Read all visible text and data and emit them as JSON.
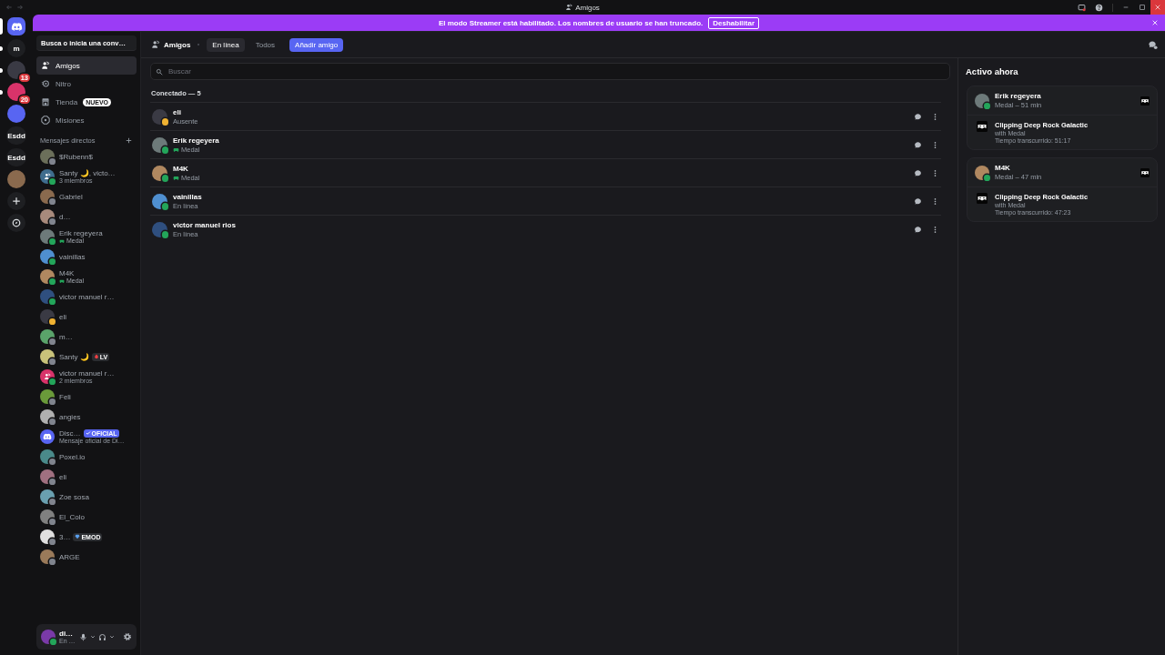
{
  "window": {
    "title": "Amigos"
  },
  "server_rail": [
    {
      "kind": "home",
      "selected": true,
      "unread": false
    },
    {
      "kind": "letter",
      "label": "m",
      "selected": false,
      "unread": true
    },
    {
      "kind": "avatar",
      "badge": "13",
      "selected": false,
      "unread": true
    },
    {
      "kind": "avatar",
      "badge": "20",
      "selected": false,
      "unread": true
    },
    {
      "kind": "avatar",
      "selected": false,
      "unread": false
    },
    {
      "kind": "letter",
      "label": "Esdd",
      "selected": false,
      "unread": false
    },
    {
      "kind": "letter",
      "label": "Esdd",
      "selected": false,
      "unread": false
    },
    {
      "kind": "avatar",
      "selected": false,
      "unread": false
    },
    {
      "kind": "add",
      "selected": false,
      "unread": false
    },
    {
      "kind": "explore",
      "selected": false,
      "unread": false
    }
  ],
  "banner": {
    "text": "El modo Streamer está habilitado. Los nombres de usuario se han truncado.",
    "button": "Deshabilitar"
  },
  "search_button": "Busca o inicia una conv…",
  "nav": [
    {
      "kind": "friends",
      "label": "Amigos",
      "selected": true
    },
    {
      "kind": "nitro",
      "label": "Nitro",
      "selected": false
    },
    {
      "kind": "shop",
      "label": "Tienda",
      "badge": "NUEVO",
      "selected": false
    },
    {
      "kind": "quests",
      "label": "Misiones",
      "selected": false
    }
  ],
  "dm_header": "Mensajes directos",
  "dm_list": [
    {
      "kind": "user",
      "name": "$Rubenn$",
      "color": "#80848e"
    },
    {
      "kind": "group",
      "name": "Santy 🌙, victo…",
      "subtitle": "3 miembros",
      "color": "#23a55a"
    },
    {
      "kind": "user",
      "name": "Gabriel",
      "color": "#80848e"
    },
    {
      "kind": "user",
      "name": "d…",
      "color": "#80848e"
    },
    {
      "kind": "user",
      "name": "Erik regeyera",
      "activity": "Medal",
      "color": "#23a55a"
    },
    {
      "kind": "user",
      "name": "vainillas",
      "color": "#23a55a"
    },
    {
      "kind": "user",
      "name": "M4K",
      "activity": "Medal",
      "color": "#23a55a"
    },
    {
      "kind": "user",
      "name": "victor manuel r…",
      "color": "#23a55a"
    },
    {
      "kind": "user",
      "name": "eli",
      "color": "#f0b232"
    },
    {
      "kind": "user",
      "name": "m…",
      "color": "#80848e"
    },
    {
      "kind": "user",
      "name": "Santy 🌙",
      "color": "#80848e",
      "tag": {
        "kind": "emblem",
        "text": "LV"
      }
    },
    {
      "kind": "group",
      "name": "victor manuel r…",
      "subtitle": "2 miembros",
      "color": "#23a55a"
    },
    {
      "kind": "user",
      "name": "Feli",
      "color": "#80848e"
    },
    {
      "kind": "user",
      "name": "angies",
      "color": "#80848e"
    },
    {
      "kind": "system",
      "name": "Disc…",
      "subtitle": "Mensaje oficial de Di…",
      "tag": {
        "kind": "official",
        "text": "OFICIAL"
      }
    },
    {
      "kind": "user",
      "name": "Poxel.io",
      "color": "#80848e"
    },
    {
      "kind": "user",
      "name": "eli",
      "color": "#80848e"
    },
    {
      "kind": "user",
      "name": "Zoe sosa",
      "color": "#80848e"
    },
    {
      "kind": "user",
      "name": "El_Colo",
      "color": "#80848e"
    },
    {
      "kind": "user",
      "name": "3…",
      "color": "#80848e",
      "tag": {
        "kind": "gem",
        "text": "EMOD"
      }
    },
    {
      "kind": "user",
      "name": "ARGE",
      "color": "#80848e"
    }
  ],
  "user_panel": {
    "name": "di…",
    "status_text": "En …",
    "color": "#23a55a"
  },
  "header": {
    "title": "Amigos",
    "tabs": [
      {
        "label": "En línea",
        "selected": true
      },
      {
        "label": "Todos",
        "selected": false
      }
    ],
    "add_button": "Añadir amigo"
  },
  "search": {
    "placeholder": "Buscar"
  },
  "section": "Conectado — 5",
  "friends": [
    {
      "name": "eli",
      "color": "#f0b232",
      "subtitle": "Ausente"
    },
    {
      "name": "Erik regeyera",
      "color": "#23a55a",
      "activity": "Medal"
    },
    {
      "name": "M4K",
      "color": "#23a55a",
      "activity": "Medal"
    },
    {
      "name": "vainillas",
      "color": "#23a55a",
      "subtitle": "En línea"
    },
    {
      "name": "victor manuel rios",
      "color": "#23a55a",
      "subtitle": "En línea"
    }
  ],
  "active_now": {
    "title": "Activo ahora",
    "cards": [
      {
        "name": "Erik regeyera",
        "color": "#23a55a",
        "detail": "Medal – 51 min",
        "activity_title": "Clipping Deep Rock Galactic",
        "activity_sub": "with Medal",
        "elapsed": "Tiempo transcurrido: 51:17"
      },
      {
        "name": "M4K",
        "color": "#23a55a",
        "detail": "Medal – 47 min",
        "activity_title": "Clipping Deep Rock Galactic",
        "activity_sub": "with Medal",
        "elapsed": "Tiempo transcurrido: 47:23"
      }
    ]
  }
}
